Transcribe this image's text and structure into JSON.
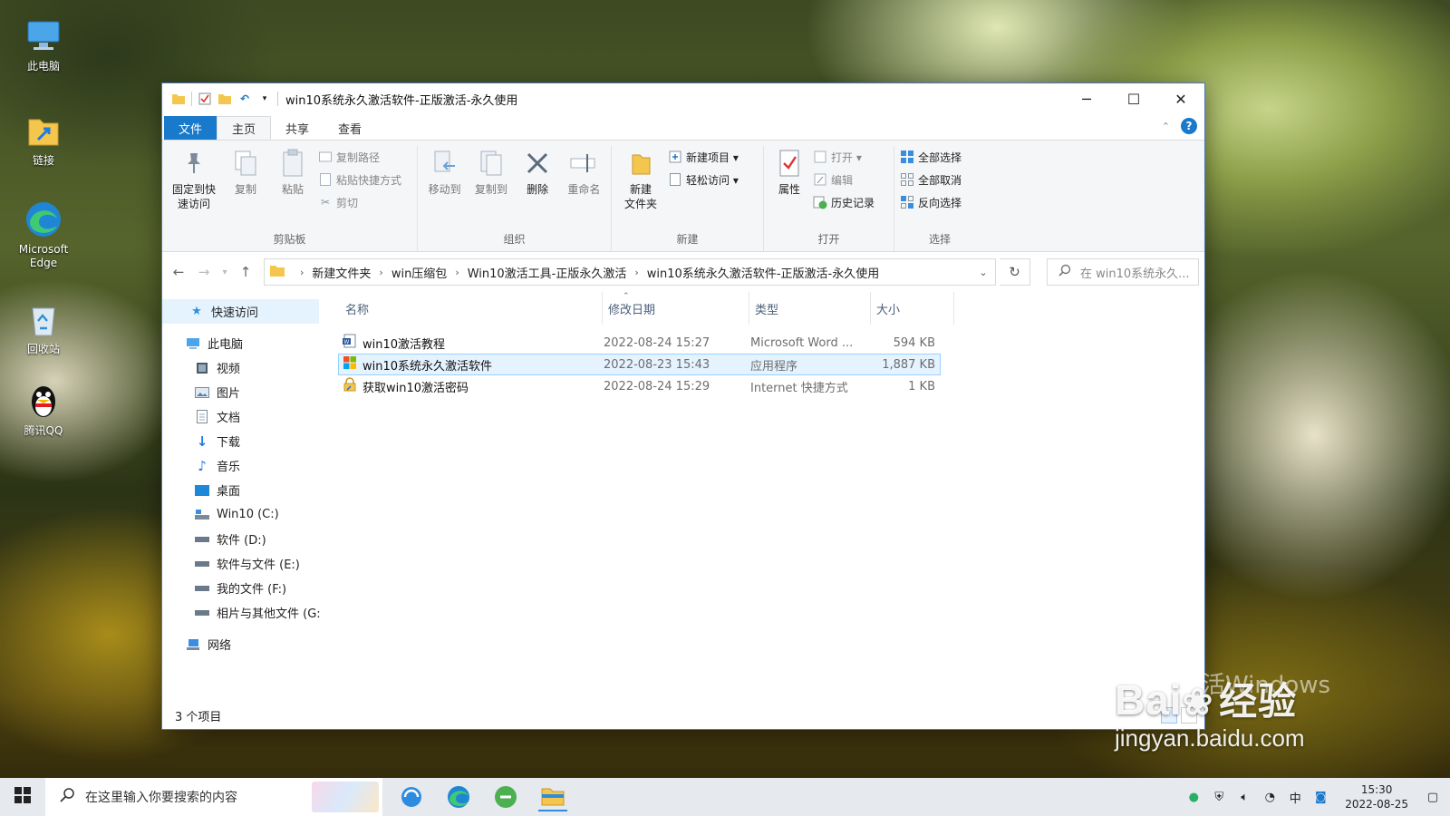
{
  "desktop": {
    "icons": [
      {
        "label": "此电脑",
        "icon": "computer-icon"
      },
      {
        "label": "链接",
        "icon": "folder-shortcut-icon"
      },
      {
        "label": "Microsoft Edge",
        "icon": "edge-icon"
      },
      {
        "label": "回收站",
        "icon": "recycle-bin-icon"
      },
      {
        "label": "腾讯QQ",
        "icon": "qq-penguin-icon"
      }
    ]
  },
  "window": {
    "title": "win10系统永久激活软件-正版激活-永久使用",
    "controls": {
      "minimize": "─",
      "maximize": "☐",
      "close": "✕"
    }
  },
  "ribbon": {
    "tabs": [
      "文件",
      "主页",
      "共享",
      "查看"
    ],
    "groups": {
      "clipboard": {
        "label": "剪贴板",
        "pin": "固定到快\n速访问",
        "copy": "复制",
        "paste": "粘贴",
        "copy_path": "复制路径",
        "paste_shortcut": "粘贴快捷方式",
        "cut": "剪切"
      },
      "organize": {
        "label": "组织",
        "move_to": "移动到",
        "copy_to": "复制到",
        "delete": "删除",
        "rename": "重命名"
      },
      "new": {
        "label": "新建",
        "new_folder": "新建\n文件夹",
        "new_item": "新建项目 ▾",
        "easy_access": "轻松访问 ▾"
      },
      "open": {
        "label": "打开",
        "properties": "属性",
        "open": "打开 ▾",
        "edit": "编辑",
        "history": "历史记录"
      },
      "select": {
        "label": "选择",
        "select_all": "全部选择",
        "select_none": "全部取消",
        "invert": "反向选择"
      }
    }
  },
  "address": {
    "crumbs": [
      "新建文件夹",
      "win压缩包",
      "Win10激活工具-正版永久激活",
      "win10系统永久激活软件-正版激活-永久使用"
    ],
    "search_placeholder": "在 win10系统永久..."
  },
  "navpane": {
    "quick_access": "快速访问",
    "this_pc": "此电脑",
    "children": [
      {
        "label": "视频",
        "icon": "video-folder-icon"
      },
      {
        "label": "图片",
        "icon": "pictures-folder-icon"
      },
      {
        "label": "文档",
        "icon": "documents-folder-icon"
      },
      {
        "label": "下载",
        "icon": "downloads-folder-icon"
      },
      {
        "label": "音乐",
        "icon": "music-folder-icon"
      },
      {
        "label": "桌面",
        "icon": "desktop-folder-icon"
      },
      {
        "label": "Win10 (C:)",
        "icon": "system-drive-icon"
      },
      {
        "label": "软件 (D:)",
        "icon": "drive-icon"
      },
      {
        "label": "软件与文件 (E:)",
        "icon": "drive-icon"
      },
      {
        "label": "我的文件 (F:)",
        "icon": "drive-icon"
      },
      {
        "label": "相片与其他文件 (G:",
        "icon": "drive-icon"
      }
    ],
    "network": "网络"
  },
  "filelist": {
    "headers": {
      "name": "名称",
      "date": "修改日期",
      "type": "类型",
      "size": "大小"
    },
    "rows": [
      {
        "name": "win10激活教程",
        "date": "2022-08-24 15:27",
        "type": "Microsoft Word ...",
        "size": "594 KB",
        "icon": "word-doc-icon",
        "selected": false
      },
      {
        "name": "win10系统永久激活软件",
        "date": "2022-08-23 15:43",
        "type": "应用程序",
        "size": "1,887 KB",
        "icon": "application-icon",
        "selected": true
      },
      {
        "name": "获取win10激活密码",
        "date": "2022-08-24 15:29",
        "type": "Internet 快捷方式",
        "size": "1 KB",
        "icon": "internet-shortcut-icon",
        "selected": false
      }
    ]
  },
  "status": {
    "count": "3 个项目"
  },
  "watermark": {
    "brand": "Bai",
    "brand2": "经验",
    "url": "jingyan.baidu.com",
    "faint": "激活Windows"
  },
  "taskbar": {
    "search_placeholder": "在这里输入你要搜索的内容",
    "apps": [
      "browser-360-icon",
      "edge-icon",
      "green-browser-icon",
      "file-explorer-icon"
    ],
    "clock_time": "15:30",
    "clock_date": "2022-08-25"
  },
  "colors": {
    "accent": "#1979ca",
    "selection": "#e5f3ff",
    "selection_border": "#99d1ff"
  }
}
